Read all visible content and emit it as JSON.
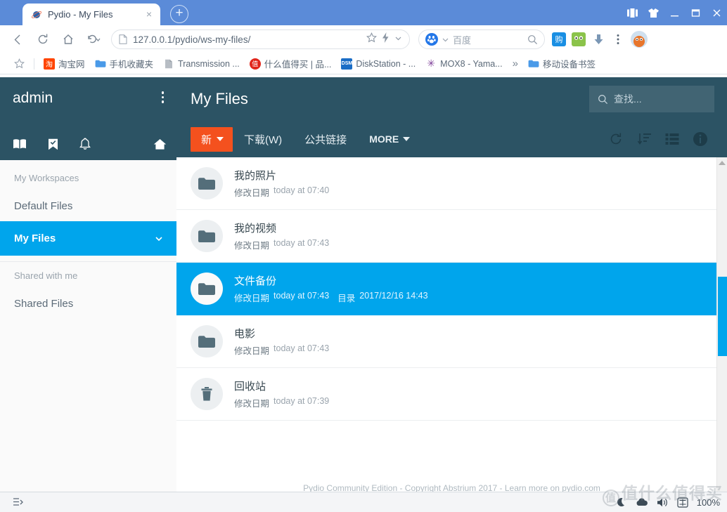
{
  "browser": {
    "tab": {
      "title": "Pydio - My Files",
      "favicon": "pydio-planet-icon",
      "close": "×"
    },
    "new_tab_label": "+",
    "window_controls": [
      {
        "name": "split-screen-button",
        "glyph": "▯▮"
      },
      {
        "name": "theme-shirt-button",
        "glyph": "👕"
      },
      {
        "name": "minimize-button",
        "glyph": "—"
      },
      {
        "name": "maximize-button",
        "glyph": "▭"
      },
      {
        "name": "close-window-button",
        "glyph": "✕"
      }
    ],
    "nav": {
      "back": "back-arrow-icon",
      "reload": "reload-icon",
      "home": "home-icon",
      "history": "history-back-icon"
    },
    "omnibox": {
      "url": "127.0.0.1/pydio/ws-my-files/",
      "page_icon": "document-icon",
      "star": "star-icon",
      "lightning": "lightning-icon",
      "chevron": "chevron-down-icon"
    },
    "search": {
      "engine": "百度",
      "placeholder": "百度",
      "value": "百度"
    },
    "extensions": [
      {
        "name": "taobao-shopping-extension",
        "glyph": "购",
        "bg": "#1a8fe3",
        "fg": "#ffffff"
      },
      {
        "name": "frog-extension",
        "glyph": "🐸",
        "bg": "#8bc34a",
        "fg": "#ffffff"
      },
      {
        "name": "download-extension",
        "glyph": "⬇",
        "bg": "transparent",
        "fg": "#78909c"
      },
      {
        "name": "browser-menu-button",
        "glyph": "⋮",
        "bg": "transparent",
        "fg": "#5a6877"
      },
      {
        "name": "user-avatar",
        "glyph": "🐯",
        "bg": "#e8e8e8",
        "fg": "#e8762c"
      }
    ],
    "bookmarks": {
      "star": "star-icon",
      "items": [
        {
          "label": "淘宝网",
          "icon": "taobao-icon",
          "bg": "#ff4400",
          "fg": "#ffffff",
          "glyph": "淘"
        },
        {
          "label": "手机收藏夹",
          "icon": "folder-icon",
          "bg": "#4a9ae8",
          "fg": "#ffffff",
          "glyph": ""
        },
        {
          "label": "Transmission ...",
          "icon": "document-icon",
          "bg": "#b7bdc4",
          "fg": "#ffffff",
          "glyph": ""
        },
        {
          "label": "什么值得买 | 品...",
          "icon": "smzdm-icon",
          "bg": "#e1251b",
          "fg": "#ffffff",
          "glyph": "值"
        },
        {
          "label": "DiskStation - ...",
          "icon": "dsm-icon",
          "bg": "#1a6dc6",
          "fg": "#ffffff",
          "glyph": "DSM"
        },
        {
          "label": "MOX8 - Yama...",
          "icon": "yamaha-icon",
          "bg": "#7e3f98",
          "fg": "#ffffff",
          "glyph": "✳"
        }
      ],
      "overflow": "»",
      "mobile_folder": {
        "label": "移动设备书签",
        "icon": "folder-icon",
        "bg": "#4a9ae8"
      }
    }
  },
  "pydio": {
    "sidebar": {
      "user": "admin",
      "menu_icon": "three-dots-vertical-icon",
      "icons": [
        {
          "name": "address-book-icon",
          "glyph": "book"
        },
        {
          "name": "bookmark-check-icon",
          "glyph": "bookmark"
        },
        {
          "name": "notifications-bell-icon",
          "glyph": "bell"
        },
        {
          "name": "home-icon",
          "glyph": "home"
        }
      ],
      "groups": [
        {
          "label": "My Workspaces"
        },
        {
          "label": "Shared with me"
        }
      ],
      "items": [
        {
          "label": "Default Files",
          "active": false,
          "chevron": ""
        },
        {
          "label": "My Files",
          "active": true,
          "chevron": "chevron-down-icon"
        },
        {
          "label": "Shared Files",
          "active": false,
          "chevron": ""
        }
      ]
    },
    "header": {
      "title": "My Files",
      "search_placeholder": "查找...",
      "search_icon": "search-icon"
    },
    "toolbar": {
      "new_label": "新",
      "download_label": "下载(W)",
      "public_link_label": "公共链接",
      "more_label": "MORE",
      "icons": [
        {
          "name": "refresh-icon"
        },
        {
          "name": "sort-icon"
        },
        {
          "name": "list-view-icon"
        },
        {
          "name": "info-icon"
        }
      ]
    },
    "files": [
      {
        "name": "我的照片",
        "icon": "folder-icon",
        "modified_label": "修改日期",
        "modified_value": "today at 07:40",
        "type_label": "",
        "type_value": "",
        "selected": false
      },
      {
        "name": "我的视频",
        "icon": "folder-icon",
        "modified_label": "修改日期",
        "modified_value": "today at 07:43",
        "type_label": "",
        "type_value": "",
        "selected": false
      },
      {
        "name": "文件备份",
        "icon": "folder-icon",
        "modified_label": "修改日期",
        "modified_value": "today at 07:43",
        "type_label": "目录",
        "type_value": "2017/12/16 14:43",
        "selected": true
      },
      {
        "name": "电影",
        "icon": "folder-icon",
        "modified_label": "修改日期",
        "modified_value": "today at 07:43",
        "type_label": "",
        "type_value": "",
        "selected": false
      },
      {
        "name": "回收站",
        "icon": "trash-icon",
        "modified_label": "修改日期",
        "modified_value": "today at 07:39",
        "type_label": "",
        "type_value": "",
        "selected": false
      }
    ],
    "footer": "Pydio Community Edition - Copyright Abstrium 2017 - Learn more on pydio.com"
  },
  "statusbar": {
    "left_icon": "taskbar-list-icon",
    "items": [
      {
        "name": "moon-icon",
        "glyph": "☾"
      },
      {
        "name": "cloud-icon",
        "glyph": "☁"
      },
      {
        "name": "volume-icon",
        "glyph": "🔊"
      },
      {
        "name": "input-method-icon",
        "glyph": "中"
      }
    ],
    "zoom": "100%"
  },
  "watermark": "值什么值得买",
  "colors": {
    "chrome_blue": "#5b8bd8",
    "pydio_dark": "#2c5364",
    "pydio_accent": "#00a5ec",
    "new_button_orange": "#f4511e"
  }
}
